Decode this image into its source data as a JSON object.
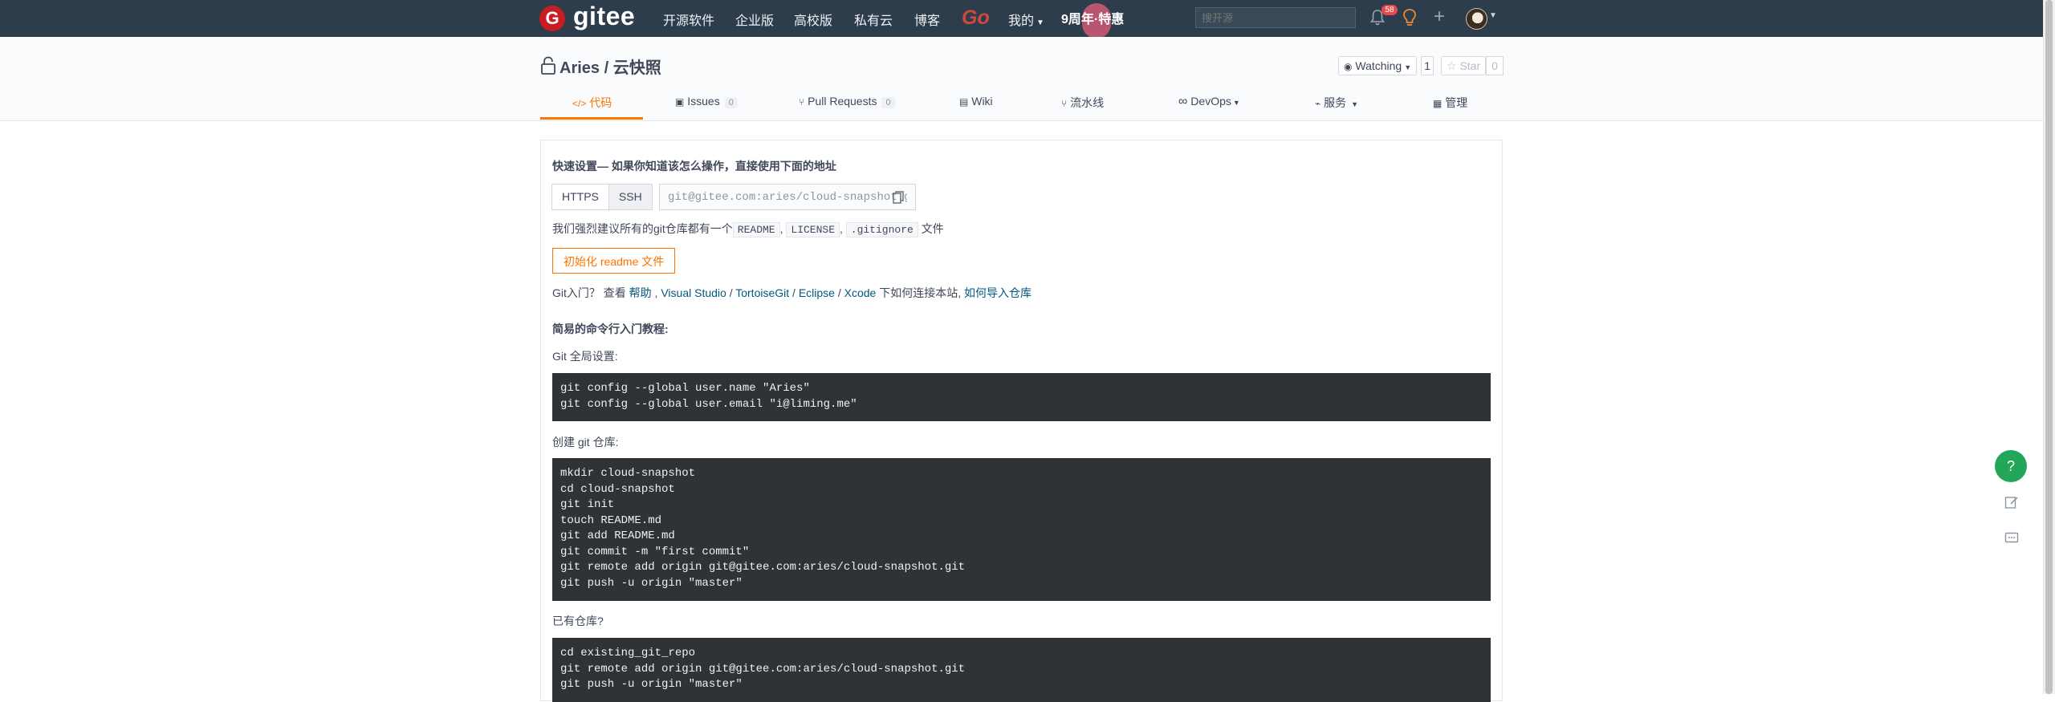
{
  "nav": {
    "logo_text": "gitee",
    "links": [
      "开源软件",
      "企业版",
      "高校版",
      "私有云",
      "博客"
    ],
    "go_label": "Go",
    "my_label": "我的",
    "promo_text": "9周年·特惠",
    "search_placeholder": "搜开源",
    "notification_count": "58"
  },
  "repo": {
    "owner": "Aries",
    "separator": " / ",
    "name": "云快照",
    "watch_label": "Watching",
    "watch_count": "1",
    "star_label": "Star",
    "star_count": "0"
  },
  "tabs": {
    "code": "代码",
    "issues": "Issues",
    "issues_count": "0",
    "pulls": "Pull Requests",
    "pulls_count": "0",
    "wiki": "Wiki",
    "pipeline": "流水线",
    "devops": "DevOps",
    "service": "服务",
    "manage": "管理"
  },
  "quick": {
    "heading": "快速设置— 如果你知道该怎么操作，直接使用下面的地址",
    "https_label": "HTTPS",
    "ssh_label": "SSH",
    "url": "git@gitee.com:aries/cloud-snapshot.git",
    "recommend_prefix": "我们强烈建议所有的git仓库都有一个",
    "readme": "README",
    "license": "LICENSE",
    "gitignore": ".gitignore",
    "recommend_suffix": "文件",
    "init_button": "初始化 readme 文件",
    "help_prefix": "Git入门？ 查看",
    "help_link": "帮助",
    "vs_link": "Visual Studio",
    "tortoise_link": "TortoiseGit",
    "eclipse_link": "Eclipse",
    "xcode_link": "Xcode",
    "connect_text": "下如何连接本站,",
    "import_link": "如何导入仓库"
  },
  "tutorial": {
    "heading": "简易的命令行入门教程:",
    "global_label": "Git 全局设置:",
    "global_code": "git config --global user.name \"Aries\"\ngit config --global user.email \"i@liming.me\"",
    "create_label": "创建 git 仓库:",
    "create_code": "mkdir cloud-snapshot\ncd cloud-snapshot\ngit init\ntouch README.md\ngit add README.md\ngit commit -m \"first commit\"\ngit remote add origin git@gitee.com:aries/cloud-snapshot.git\ngit push -u origin \"master\"",
    "existing_label": "已有仓库?",
    "existing_code": "cd existing_git_repo\ngit remote add origin git@gitee.com:aries/cloud-snapshot.git\ngit push -u origin \"master\""
  },
  "float": {
    "help": "?"
  },
  "colors": {
    "nav_bg": "#2e3d4c",
    "accent": "#fe7300",
    "code_bg": "#2e3337",
    "link": "#005980",
    "help_green": "#23a659"
  }
}
